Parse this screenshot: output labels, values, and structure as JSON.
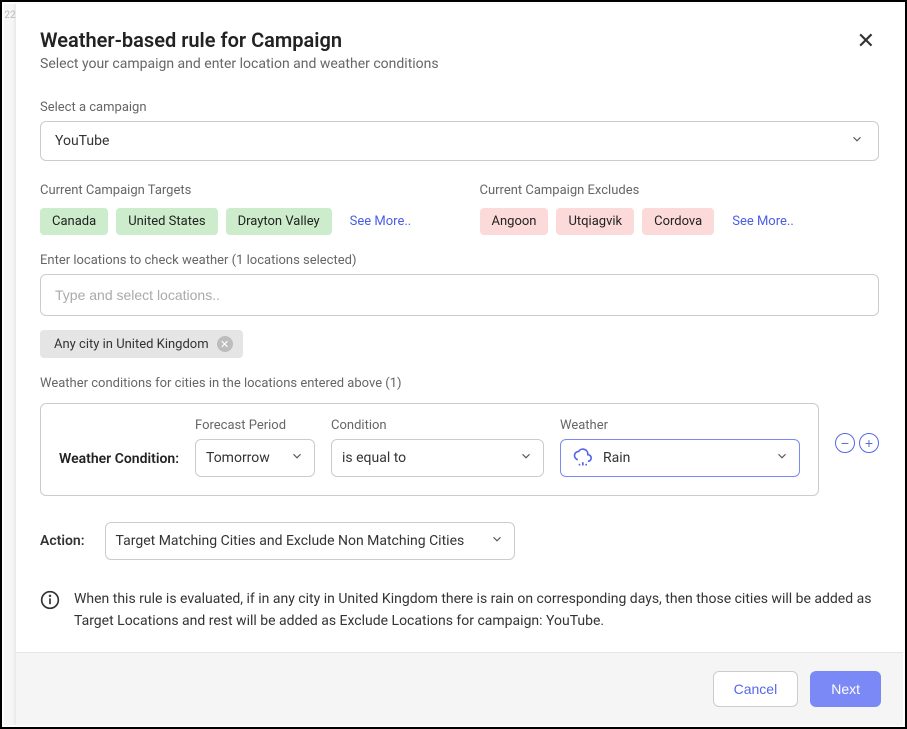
{
  "edge_strip": "22",
  "header": {
    "title": "Weather-based rule for Campaign",
    "subtitle": "Select your campaign and enter location and weather conditions"
  },
  "campaign": {
    "label": "Select a campaign",
    "selected": "YouTube"
  },
  "targets": {
    "label": "Current Campaign Targets",
    "chips": [
      "Canada",
      "United States",
      "Drayton Valley"
    ],
    "see_more": "See More.."
  },
  "excludes": {
    "label": "Current Campaign Excludes",
    "chips": [
      "Angoon",
      "Utqiagvik",
      "Cordova"
    ],
    "see_more": "See More.."
  },
  "locations": {
    "label": "Enter locations to check weather (1 locations selected)",
    "placeholder": "Type and select locations..",
    "selected": [
      "Any city in United Kingdom"
    ]
  },
  "conditions": {
    "label": "Weather conditions for cities in the locations entered above (1)",
    "row_title": "Weather Condition:",
    "forecast_label": "Forecast Period",
    "forecast_value": "Tomorrow",
    "condition_label": "Condition",
    "condition_value": "is equal to",
    "weather_label": "Weather",
    "weather_value": "Rain"
  },
  "action": {
    "label": "Action:",
    "value": "Target Matching Cities and Exclude Non Matching Cities"
  },
  "info": {
    "text": "When this rule is evaluated, if in any city in United Kingdom there is rain on corresponding days, then those cities will be added as Target Locations and rest will be added as Exclude Locations for campaign: YouTube."
  },
  "footer": {
    "cancel": "Cancel",
    "next": "Next"
  }
}
